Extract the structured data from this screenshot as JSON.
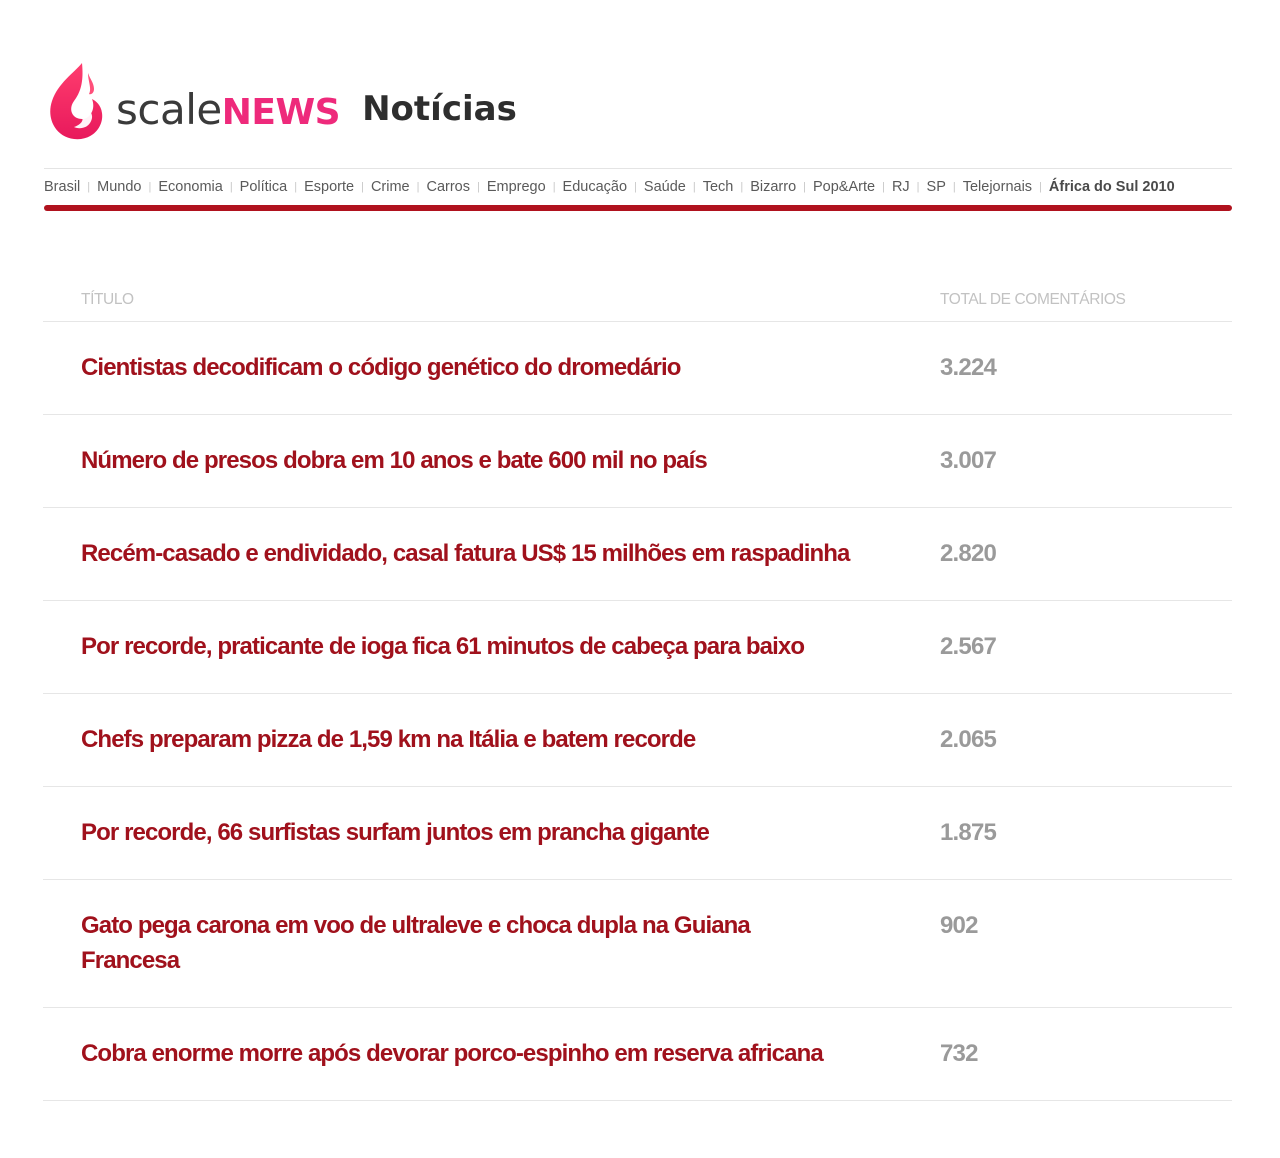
{
  "brand": {
    "scale": "scale",
    "news": "NEWS",
    "section": "Notícias",
    "accent_color": "#ee2a7b",
    "logo_icon": "flame-icon"
  },
  "nav": {
    "items": [
      {
        "label": "Brasil"
      },
      {
        "label": "Mundo"
      },
      {
        "label": "Economia"
      },
      {
        "label": "Política"
      },
      {
        "label": "Esporte"
      },
      {
        "label": "Crime"
      },
      {
        "label": "Carros"
      },
      {
        "label": "Emprego"
      },
      {
        "label": "Educação"
      },
      {
        "label": "Saúde"
      },
      {
        "label": "Tech"
      },
      {
        "label": "Bizarro"
      },
      {
        "label": "Pop&Arte"
      },
      {
        "label": "RJ"
      },
      {
        "label": "SP"
      },
      {
        "label": "Telejornais"
      },
      {
        "label": "África do Sul 2010",
        "bold": true
      }
    ],
    "underline_color": "#b0121e"
  },
  "table": {
    "headers": {
      "title": "TÍTULO",
      "count": "TOTAL DE COMENTÁRIOS"
    },
    "rows": [
      {
        "title": "Cientistas decodificam o código genético do dromedário",
        "count": "3.224"
      },
      {
        "title": "Número de presos dobra em 10 anos e bate 600 mil no país",
        "count": "3.007"
      },
      {
        "title": "Recém-casado e endividado, casal fatura US$ 15 milhões em raspadinha",
        "count": "2.820"
      },
      {
        "title": "Por recorde, praticante de ioga fica 61 minutos de cabeça para baixo",
        "count": "2.567"
      },
      {
        "title": "Chefs preparam pizza de 1,59 km na Itália e batem recorde",
        "count": "2.065"
      },
      {
        "title": "Por recorde, 66 surfistas surfam juntos em prancha gigante",
        "count": "1.875"
      },
      {
        "title": "Gato pega carona em voo de ultraleve e choca dupla na Guiana Francesa",
        "count": "902"
      },
      {
        "title": "Cobra enorme morre após devorar porco-espinho em reserva africana",
        "count": "732"
      }
    ],
    "title_color": "#a0111c",
    "count_color": "#9a9a9a"
  }
}
